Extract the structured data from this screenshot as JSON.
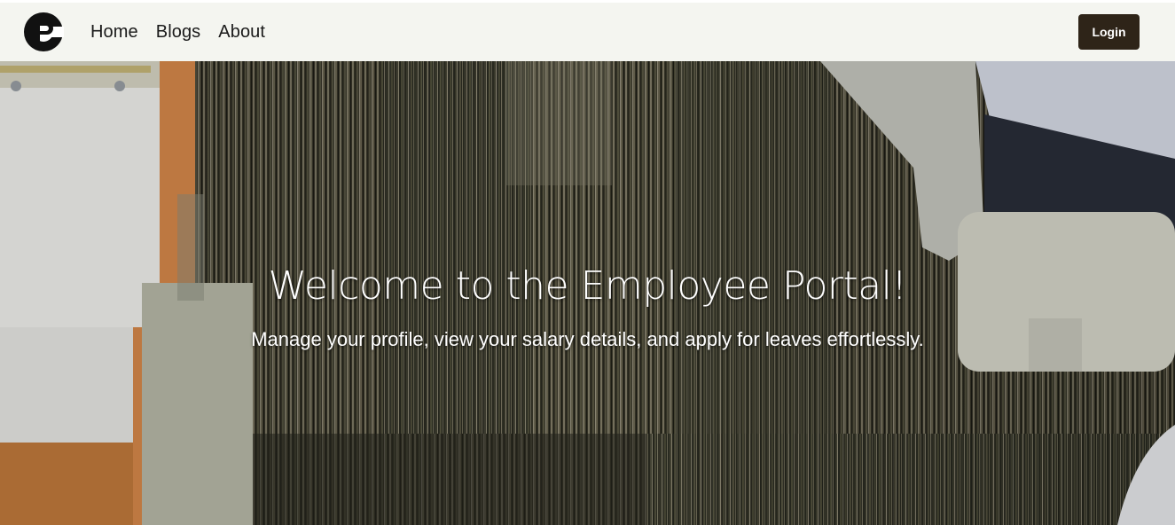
{
  "navbar": {
    "logo_icon": "pc-logo-icon",
    "links": [
      {
        "label": "Home"
      },
      {
        "label": "Blogs"
      },
      {
        "label": "About"
      }
    ],
    "login_label": "Login"
  },
  "hero": {
    "title": "Welcome to the Employee Portal!",
    "subtitle": "Manage your profile, view your salary details, and apply for leaves effortlessly.",
    "background": "top-down office photo: carpet, binder, chair, person"
  },
  "colors": {
    "navbar_bg": "#f4f5f0",
    "login_bg": "#2e2418",
    "text_dark": "#1a1a1a",
    "hero_text": "#ffffff"
  }
}
